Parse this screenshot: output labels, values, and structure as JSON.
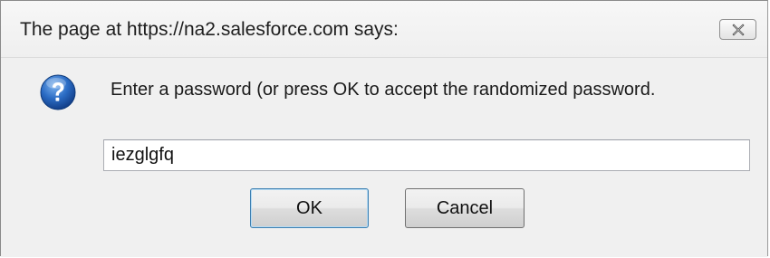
{
  "dialog": {
    "title": "The page at https://na2.salesforce.com says:",
    "message": "Enter a password (or press OK to accept the randomized password.",
    "input": {
      "value": "iezglgfq",
      "placeholder": ""
    },
    "buttons": {
      "ok_label": "OK",
      "cancel_label": "Cancel"
    },
    "icons": {
      "prompt": "question-icon",
      "close": "close-icon"
    },
    "colors": {
      "icon_blue": "#1f5fb8",
      "ok_border": "#3c7fb1"
    }
  }
}
